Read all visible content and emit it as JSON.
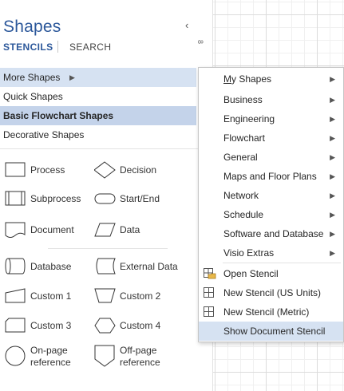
{
  "pane": {
    "title": "Shapes",
    "collapse_glyph": "‹",
    "tabs": {
      "stencils": "STENCILS",
      "search": "SEARCH"
    },
    "stencils": {
      "more": "More Shapes",
      "quick": "Quick Shapes",
      "basic": "Basic Flowchart Shapes",
      "decorative": "Decorative Shapes"
    },
    "shapes": {
      "process": "Process",
      "decision": "Decision",
      "subprocess": "Subprocess",
      "startend": "Start/End",
      "document": "Document",
      "data": "Data",
      "database": "Database",
      "external_data": "External Data",
      "custom1": "Custom 1",
      "custom2": "Custom 2",
      "custom3": "Custom 3",
      "custom4": "Custom 4",
      "onpage_l1": "On-page",
      "onpage_l2": "reference",
      "offpage_l1": "Off-page",
      "offpage_l2": "reference"
    }
  },
  "canvas": {
    "ruler_label": "8"
  },
  "menu": {
    "my_shapes_u": "M",
    "my_shapes_rest": "y Shapes",
    "items": {
      "business": "Business",
      "engineering": "Engineering",
      "flowchart": "Flowchart",
      "general": "General",
      "maps": "Maps and Floor Plans",
      "network": "Network",
      "schedule": "Schedule",
      "software": "Software and Database",
      "visio_extras": "Visio Extras"
    },
    "open_stencil": "Open Stencil",
    "new_stencil_us": "New Stencil (US Units)",
    "new_stencil_metric": "New Stencil (Metric)",
    "show_doc_stencil": "Show Document Stencil"
  },
  "colors": {
    "accent": "#2b579a",
    "highlight": "#d6e2f2",
    "selected": "#c4d3ea"
  }
}
